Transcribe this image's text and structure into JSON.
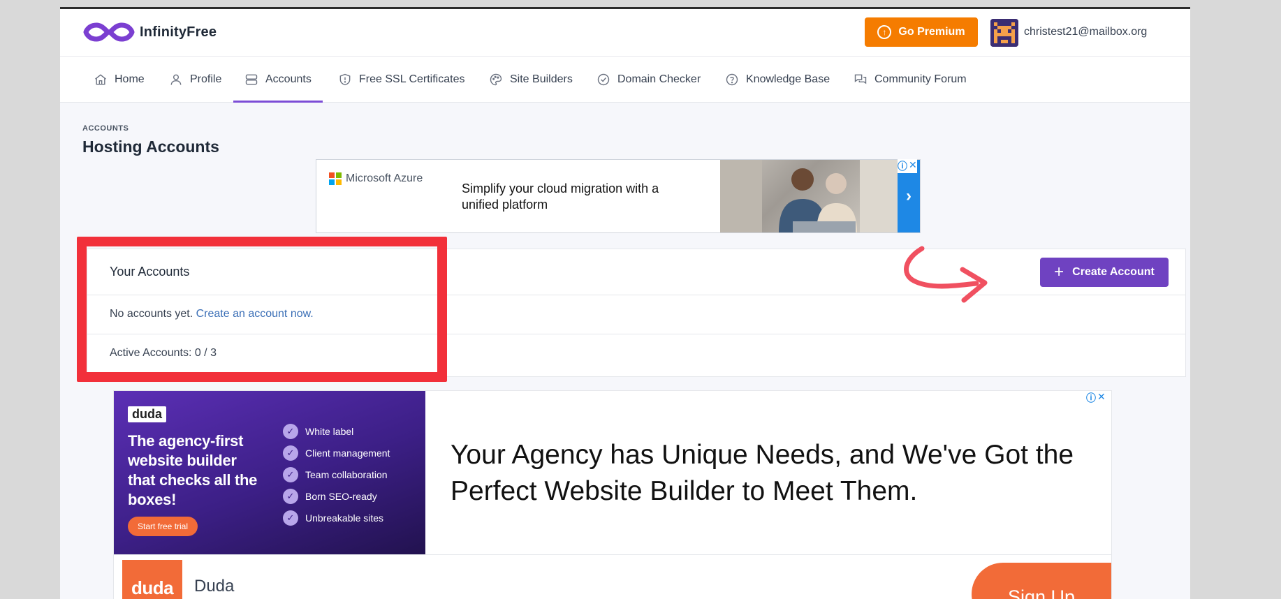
{
  "header": {
    "logo_text": "InfinityFree",
    "premium_label": "Go Premium",
    "user_email": "christest21@mailbox.org"
  },
  "nav": {
    "items": [
      {
        "label": "Home",
        "icon": "home-icon"
      },
      {
        "label": "Profile",
        "icon": "user-icon"
      },
      {
        "label": "Accounts",
        "icon": "server-icon"
      },
      {
        "label": "Free SSL Certificates",
        "icon": "shield-icon"
      },
      {
        "label": "Site Builders",
        "icon": "palette-icon"
      },
      {
        "label": "Domain Checker",
        "icon": "check-circle-icon"
      },
      {
        "label": "Knowledge Base",
        "icon": "help-circle-icon"
      },
      {
        "label": "Community Forum",
        "icon": "chat-icon"
      }
    ],
    "active": "Accounts"
  },
  "page": {
    "breadcrumb": "ACCOUNTS",
    "title": "Hosting Accounts"
  },
  "ad_top": {
    "brand": "Microsoft Azure",
    "text": "Simplify your cloud migration with a unified platform",
    "next_glyph": "›"
  },
  "accounts_card": {
    "title": "Your Accounts",
    "create_label": "Create Account",
    "empty_text": "No accounts yet.",
    "empty_link": "Create an account now.",
    "active_text": "Active Accounts: 0 / 3"
  },
  "ad_bottom": {
    "tag": "duda",
    "headline": "The agency-first website builder that checks all the boxes!",
    "trial_label": "Start free trial",
    "features": [
      "White label",
      "Client management",
      "Team collaboration",
      "Born SEO-ready",
      "Unbreakable sites"
    ],
    "big_text": "Your Agency has Unique Needs, and We've Got the Perfect Website Builder to Meet Them.",
    "logo_text": "duda",
    "advertiser": "Duda",
    "signup_label": "Sign Up"
  },
  "colors": {
    "accent": "#6f42c1",
    "premium": "#f57c00",
    "highlight": "#f2303a",
    "link": "#3b6fb6",
    "duda_orange": "#f26b38"
  }
}
